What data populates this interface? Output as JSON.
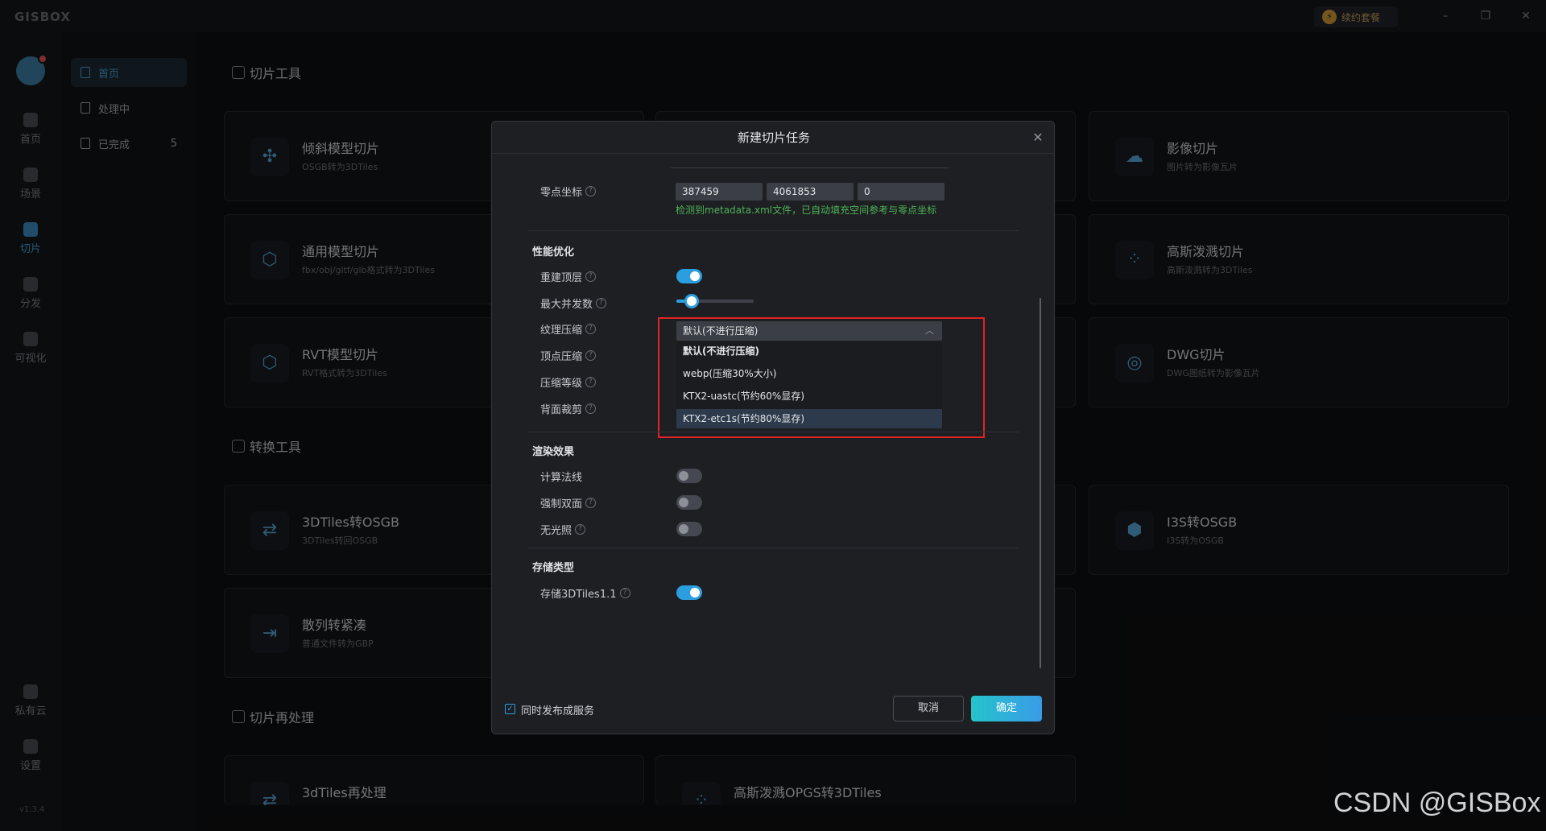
{
  "app": {
    "logo": "GISBOX",
    "package_label": "续约套餐",
    "version": "v1.3.4",
    "window_controls": [
      "–",
      "❐",
      "✕"
    ]
  },
  "rail": {
    "items": [
      {
        "label": "首页",
        "icon": "home-icon"
      },
      {
        "label": "场景",
        "icon": "scene-icon"
      },
      {
        "label": "切片",
        "icon": "tile-icon",
        "active": true
      },
      {
        "label": "分发",
        "icon": "distribute-icon"
      },
      {
        "label": "可视化",
        "icon": "visualize-icon"
      }
    ],
    "bottom_items": [
      {
        "label": "私有云",
        "icon": "cloud-icon"
      },
      {
        "label": "设置",
        "icon": "settings-icon"
      }
    ]
  },
  "subnav": {
    "items": [
      {
        "label": "首页",
        "active": true
      },
      {
        "label": "处理中"
      },
      {
        "label": "已完成",
        "count": "5"
      }
    ]
  },
  "main": {
    "sections": {
      "tile_tools": "切片工具",
      "convert_tools": "转换工具",
      "reprocess": "切片再处理"
    },
    "cards": {
      "oblique": {
        "title": "倾斜模型切片",
        "desc": "OSGB转为3DTiles"
      },
      "image": {
        "title": "影像切片",
        "desc": "图片转为影像瓦片"
      },
      "general": {
        "title": "通用模型切片",
        "desc": "fbx/obj/gltf/glb格式转为3DTiles"
      },
      "gaussian": {
        "title": "高斯泼溅切片",
        "desc": "高斯泼溅转为3DTiles"
      },
      "rvt": {
        "title": "RVT模型切片",
        "desc": "RVT格式转为3DTiles"
      },
      "dwg": {
        "title": "DWG切片",
        "desc": "DWG图纸转为影像瓦片"
      },
      "tiles2osgb": {
        "title": "3DTiles转OSGB",
        "desc": "3DTiles转回OSGB"
      },
      "i3s2osgb": {
        "title": "I3S转OSGB",
        "desc": "I3S转为OSGB"
      },
      "scatter": {
        "title": "散列转紧凑",
        "desc": "普通文件转为GBP"
      },
      "tiles_reprocess": {
        "title": "3dTiles再处理",
        "desc": ""
      },
      "opgs": {
        "title": "高斯泼溅OPGS转3DTiles",
        "desc": ""
      }
    }
  },
  "dialog": {
    "title": "新建切片任务",
    "zero_coord": {
      "label": "零点坐标",
      "x": "387459",
      "y": "4061853",
      "z": "0",
      "hint": "检测到metadata.xml文件，已自动填充空间参考与零点坐标"
    },
    "performance": {
      "title": "性能优化",
      "rebuild_top": {
        "label": "重建顶层",
        "on": true
      },
      "max_concurrency": {
        "label": "最大并发数",
        "level": 0.2
      },
      "texture_compress": {
        "label": "纹理压缩",
        "selected": "默认(不进行压缩)",
        "options": [
          "默认(不进行压缩)",
          "webp(压缩30%大小)",
          "KTX2-uastc(节约60%显存)",
          "KTX2-etc1s(节约80%显存)"
        ],
        "highlighted_index": 3
      },
      "vertex_compress": {
        "label": "顶点压缩"
      },
      "compress_level": {
        "label": "压缩等级"
      },
      "backface_cull": {
        "label": "背面裁剪"
      }
    },
    "render": {
      "title": "渲染效果",
      "normals": {
        "label": "计算法线",
        "on": false
      },
      "double_side": {
        "label": "强制双面",
        "on": false
      },
      "unlit": {
        "label": "无光照",
        "on": false
      }
    },
    "storage": {
      "title": "存储类型",
      "tiles11": {
        "label": "存储3DTiles1.1",
        "on": true
      }
    },
    "footer": {
      "publish_label": "同时发布成服务",
      "publish_checked": true,
      "cancel": "取消",
      "ok": "确定"
    }
  },
  "watermark": "CSDN @GISBox",
  "colors": {
    "accent": "#2b9ee0",
    "hint_green": "#4fb355",
    "highlight_box": "#e02424"
  }
}
